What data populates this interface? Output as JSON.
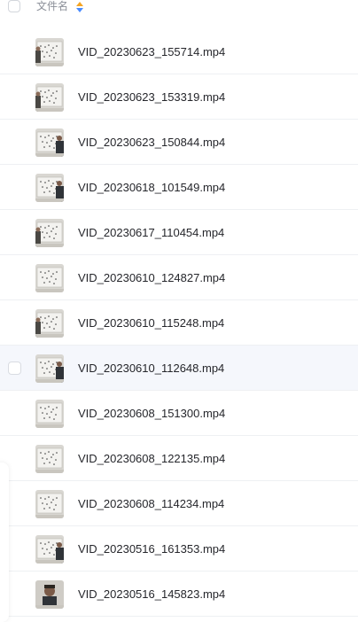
{
  "header": {
    "column_title": "文件名",
    "sort_icon": "sort-icon",
    "colors": {
      "sort_up": "#f5a524",
      "sort_down": "#4a8cff"
    }
  },
  "files": [
    {
      "name": "VID_20230623_155714.mp4",
      "thumb": "whiteboard-person-left"
    },
    {
      "name": "VID_20230623_153319.mp4",
      "thumb": "whiteboard-person-left"
    },
    {
      "name": "VID_20230623_150844.mp4",
      "thumb": "whiteboard-person-right"
    },
    {
      "name": "VID_20230618_101549.mp4",
      "thumb": "whiteboard-person-right"
    },
    {
      "name": "VID_20230617_110454.mp4",
      "thumb": "whiteboard-person-left"
    },
    {
      "name": "VID_20230610_124827.mp4",
      "thumb": "whiteboard"
    },
    {
      "name": "VID_20230610_115248.mp4",
      "thumb": "whiteboard-person-left"
    },
    {
      "name": "VID_20230610_112648.mp4",
      "thumb": "whiteboard-person-right",
      "hover": true
    },
    {
      "name": "VID_20230608_151300.mp4",
      "thumb": "whiteboard"
    },
    {
      "name": "VID_20230608_122135.mp4",
      "thumb": "whiteboard"
    },
    {
      "name": "VID_20230608_114234.mp4",
      "thumb": "whiteboard"
    },
    {
      "name": "VID_20230516_161353.mp4",
      "thumb": "whiteboard-person-right"
    },
    {
      "name": "VID_20230516_145823.mp4",
      "thumb": "person-portrait"
    }
  ]
}
